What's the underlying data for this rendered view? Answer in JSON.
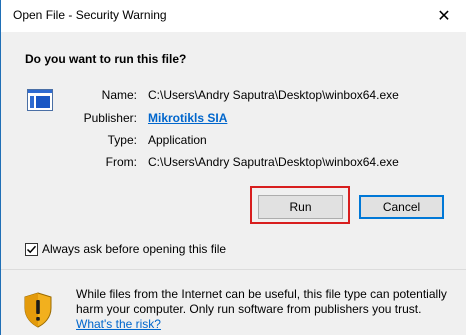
{
  "window": {
    "title": "Open File - Security Warning",
    "close_glyph": "✕"
  },
  "prompt": {
    "question": "Do you want to run this file?"
  },
  "details": [
    {
      "label": "Name:",
      "value": "C:\\Users\\Andry Saputra\\Desktop\\winbox64.exe"
    },
    {
      "label": "Publisher:",
      "value": "Mikrotikls SIA"
    },
    {
      "label": "Type:",
      "value": "Application"
    },
    {
      "label": "From:",
      "value": "C:\\Users\\Andry Saputra\\Desktop\\winbox64.exe"
    }
  ],
  "buttons": {
    "run_label": "Run",
    "cancel_label": "Cancel"
  },
  "checkbox": {
    "label": "Always ask before opening this file",
    "checked": true
  },
  "warning": {
    "text": "While files from the Internet can be useful, this file type can potentially harm your computer. Only run software from publishers you trust.",
    "link": "What's the risk?"
  },
  "colors": {
    "highlight": "#d81e1e",
    "link": "#0066cc",
    "accent": "#0078d7"
  },
  "icons": {
    "file": "application-window-icon",
    "shield": "security-shield-icon",
    "close": "close-icon",
    "check": "checkmark-icon"
  }
}
